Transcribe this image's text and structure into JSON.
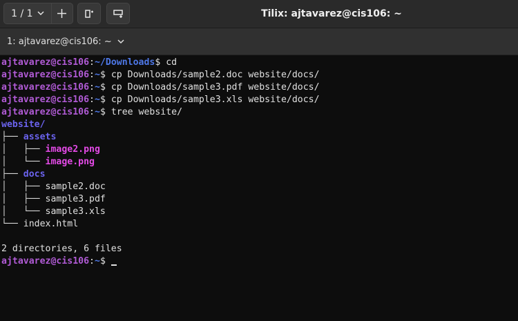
{
  "window": {
    "title": "Tilix: ajtavarez@cis106: ~"
  },
  "toolbar": {
    "session_count": "1 / 1"
  },
  "tab": {
    "label": "1: ajtavarez@cis106: ~"
  },
  "terminal": {
    "prompt_user": "ajtavarez@cis106",
    "lines": {
      "l1_path": "~/Downloads",
      "l1_cmd": " cd",
      "l2_path": "~",
      "l2_cmd": " cp Downloads/sample2.doc website/docs/",
      "l3_path": "~",
      "l3_cmd": " cp Downloads/sample3.pdf website/docs/",
      "l4_path": "~",
      "l4_cmd": " cp Downloads/sample3.xls website/docs/",
      "l5_path": "~",
      "l5_cmd": " tree website/",
      "root": "website/",
      "assets": "assets",
      "image2": "image2.png",
      "image": "image.png",
      "docs": "docs",
      "sample2": "sample2.doc",
      "sample3pdf": "sample3.pdf",
      "sample3xls": "sample3.xls",
      "index": "index.html",
      "summary": "2 directories, 6 files",
      "l_last_path": "~"
    }
  }
}
